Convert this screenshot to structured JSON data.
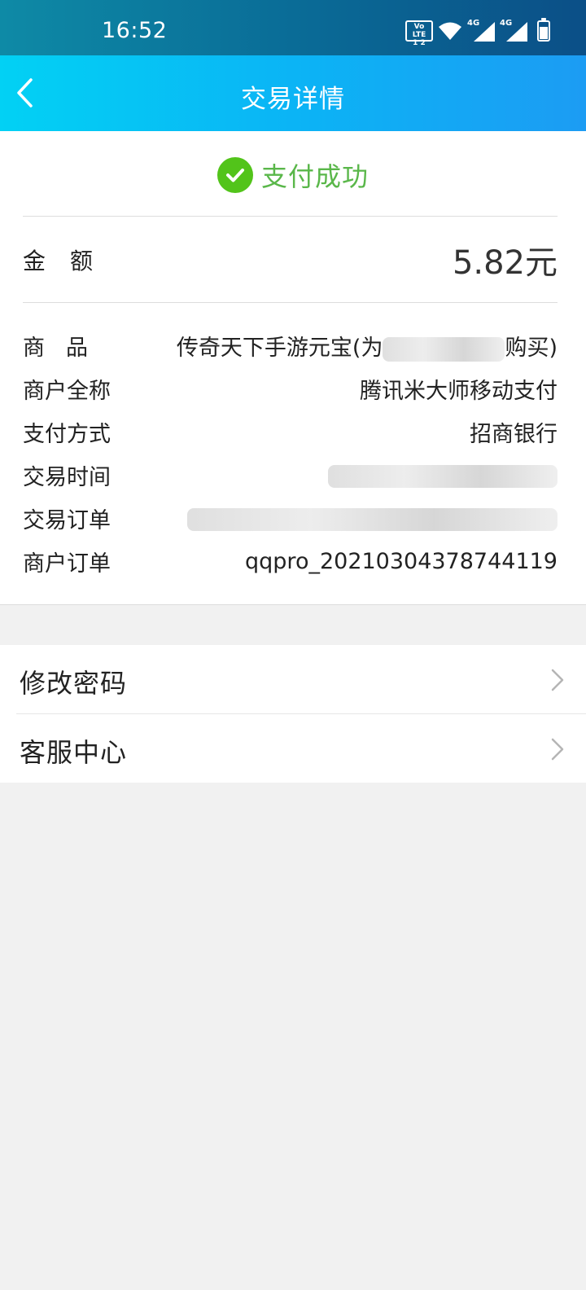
{
  "status_bar": {
    "time": "16:52",
    "volte_top": "Vo LTE",
    "volte_bottom": "1 2",
    "net1": "4G",
    "net2": "4G"
  },
  "header": {
    "title": "交易详情"
  },
  "status": {
    "text": "支付成功",
    "color": "#52c41a"
  },
  "amount": {
    "label": "金额",
    "value": "5.82元"
  },
  "details": [
    {
      "label": "商品",
      "value_prefix": "传奇天下手游元宝(为",
      "value_suffix": "购买)"
    },
    {
      "label": "商户全称",
      "value": "腾讯米大师移动支付"
    },
    {
      "label": "支付方式",
      "value": "招商银行"
    },
    {
      "label": "交易时间",
      "value": ""
    },
    {
      "label": "交易订单",
      "value": ""
    },
    {
      "label": "商户订单",
      "value": "qqpro_20210304378744119"
    }
  ],
  "menu": [
    {
      "label": "修改密码"
    },
    {
      "label": "客服中心"
    }
  ]
}
